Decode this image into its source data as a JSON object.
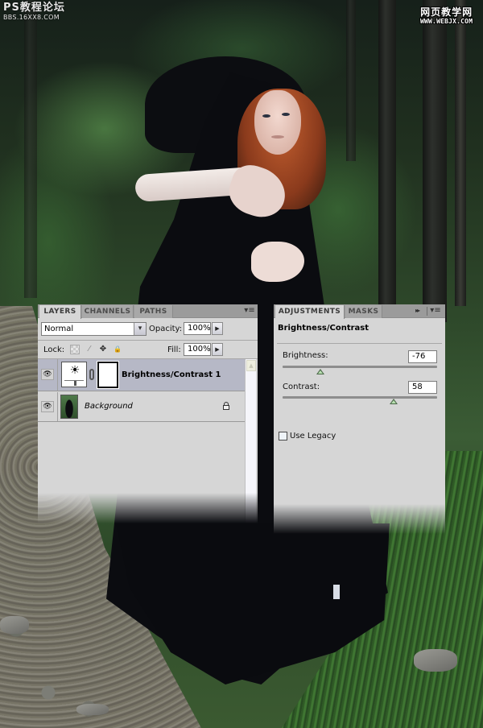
{
  "watermarks": {
    "left_title": "PS教程论坛",
    "left_sub": "BBS.16XX8.COM",
    "right_title": "网页教学网",
    "right_sub": "WWW.WEBJX.COM"
  },
  "layers_panel": {
    "tabs": [
      {
        "label": "LAYERS",
        "active": true
      },
      {
        "label": "CHANNELS",
        "active": false
      },
      {
        "label": "PATHS",
        "active": false
      }
    ],
    "menu_icon": "panel-menu-icon",
    "blend_mode": "Normal",
    "opacity_label": "Opacity:",
    "opacity_value": "100%",
    "lock_label": "Lock:",
    "fill_label": "Fill:",
    "fill_value": "100%",
    "lock_icons": [
      "lock-transparent-pixels-icon",
      "lock-image-pixels-icon",
      "lock-position-icon",
      "lock-all-icon"
    ],
    "layers": [
      {
        "name": "Brightness/Contrast 1",
        "visible": true,
        "selected": true,
        "type": "adjustment",
        "has_mask": true
      },
      {
        "name": "Background",
        "visible": true,
        "selected": false,
        "type": "image",
        "locked": true
      }
    ],
    "icons": {
      "eye": "👁",
      "sun": "☀",
      "dropdown": "▾",
      "stepper": "▶",
      "move": "✥",
      "brush": "⁄",
      "lock": "🔒",
      "scroll_up": "▲",
      "menu": "▾≡"
    }
  },
  "adjustments_panel": {
    "tabs": [
      {
        "label": "ADJUSTMENTS",
        "active": true
      },
      {
        "label": "MASKS",
        "active": false
      }
    ],
    "forward_icon": "▸▸",
    "menu_icon": "▾≡",
    "title": "Brightness/Contrast",
    "brightness_label": "Brightness:",
    "brightness_value": "-76",
    "brightness": -76,
    "brightness_range": [
      -150,
      150
    ],
    "contrast_label": "Contrast:",
    "contrast_value": "58",
    "contrast": 58,
    "contrast_range": [
      -50,
      100
    ],
    "use_legacy_label": "Use Legacy",
    "use_legacy_checked": false
  },
  "colors": {
    "panel_bg": "#d6d6d6",
    "tab_inactive": "#a8a8a8",
    "selected_layer": "#b6b8c6",
    "slider_thumb": "#b8e0b0"
  }
}
